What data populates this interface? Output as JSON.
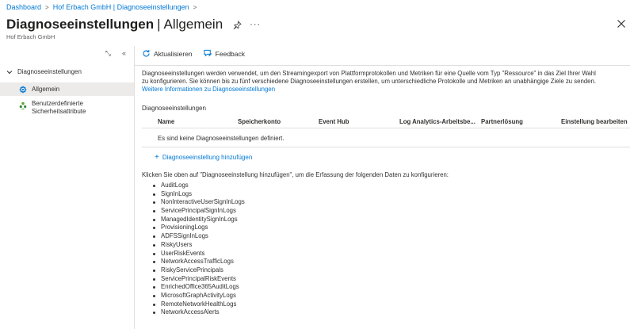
{
  "breadcrumb": {
    "items": [
      "Dashboard",
      "Hof Erbach GmbH | Diagnoseeinstellungen"
    ]
  },
  "header": {
    "title": "Diagnoseeinstellungen",
    "separator": "|",
    "subtitle": "Allgemein",
    "more": "···",
    "resource_name": "Hof Erbach GmbH"
  },
  "sidebar": {
    "tool_expand": "⤡",
    "tool_collapse": "«",
    "group_label": "Diagnoseeinstellungen",
    "items": [
      {
        "label": "Allgemein",
        "active": true
      },
      {
        "label_line1": "Benutzerdefinierte",
        "label_line2": "Sicherheitsattribute",
        "active": false
      }
    ]
  },
  "toolbar": {
    "refresh_label": "Aktualisieren",
    "feedback_label": "Feedback"
  },
  "main": {
    "description_line1": "Diagnoseeinstellungen werden verwendet, um den Streamingexport von Plattformprotokollen und Metriken für eine Quelle vom Typ \"Ressource\" in das Ziel Ihrer Wahl",
    "description_line2": "zu konfigurieren. Sie können bis zu fünf verschiedene Diagnoseeinstellungen erstellen, um unterschiedliche Protokolle und Metriken an unabhängige Ziele zu senden.",
    "learn_more_link": "Weitere Informationen zu Diagnoseeinstellungen",
    "section_label": "Diagnoseeinstellungen",
    "table": {
      "columns": [
        "Name",
        "Speicherkonto",
        "Event Hub",
        "Log Analytics-Arbeitsbe...",
        "Partnerlösung",
        "Einstellung bearbeiten"
      ],
      "empty_message": "Es sind keine Diagnoseeinstellungen definiert."
    },
    "add_plus": "+",
    "add_label": "Diagnoseeinstellung hinzufügen",
    "intro": "Klicken Sie oben auf \"Diagnoseeinstellung hinzufügen\", um die Erfassung der folgenden Daten zu konfigurieren:",
    "logs": [
      "AuditLogs",
      "SignInLogs",
      "NonInteractiveUserSignInLogs",
      "ServicePrincipalSignInLogs",
      "ManagedIdentitySignInLogs",
      "ProvisioningLogs",
      "ADFSSignInLogs",
      "RiskyUsers",
      "UserRiskEvents",
      "NetworkAccessTrafficLogs",
      "RiskyServicePrincipals",
      "ServicePrincipalRiskEvents",
      "EnrichedOffice365AuditLogs",
      "MicrosoftGraphActivityLogs",
      "RemoteNetworkHealthLogs",
      "NetworkAccessAlerts"
    ]
  },
  "colors": {
    "link": "#0078d4",
    "text": "#323130",
    "active_bg": "#edebe9"
  }
}
